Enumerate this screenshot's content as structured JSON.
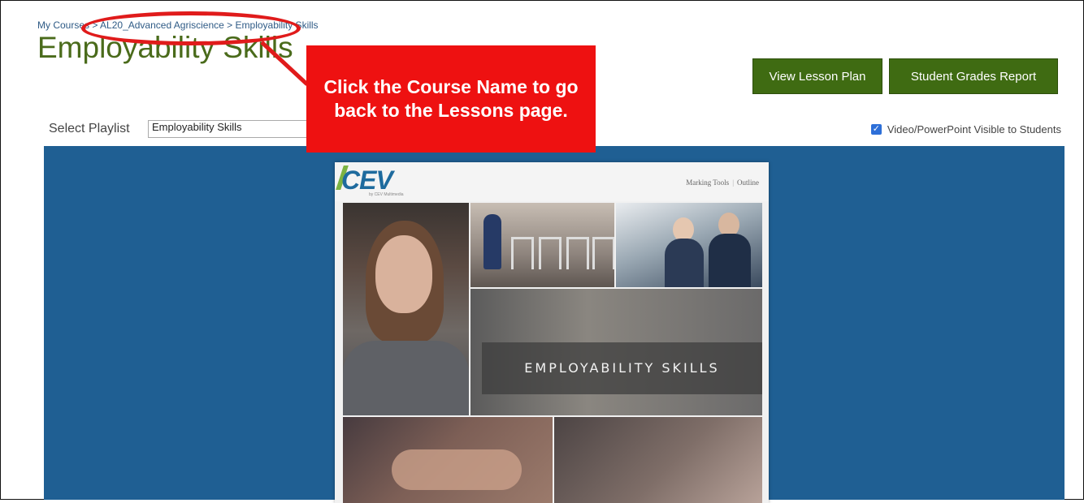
{
  "breadcrumb": {
    "item1": "My Courses",
    "item2": "AL20_Advanced Agriscience",
    "item3": "Employability Skills",
    "separator": ">"
  },
  "page": {
    "title": "Employability Skills"
  },
  "buttons": {
    "view_lesson_plan": "View Lesson Plan",
    "student_grades_report": "Student Grades Report"
  },
  "playlist": {
    "label": "Select Playlist",
    "selected": "Employability Skills"
  },
  "visibility": {
    "label": "Video/PowerPoint Visible to Students",
    "checked": true
  },
  "slide": {
    "logo": "CEV",
    "logo_sub": "by CEV Multimedia",
    "nav_marking_tools": "Marking Tools",
    "nav_outline": "Outline",
    "title": "EMPLOYABILITY SKILLS"
  },
  "annotation": {
    "callout_text": "Click the Course Name to go back to the Lessons page.",
    "color": "#ee1111"
  },
  "colors": {
    "title_green": "#4a6b1b",
    "button_green": "#3f6b12",
    "player_blue": "#1f5f93",
    "link_blue": "#2f5b86"
  }
}
